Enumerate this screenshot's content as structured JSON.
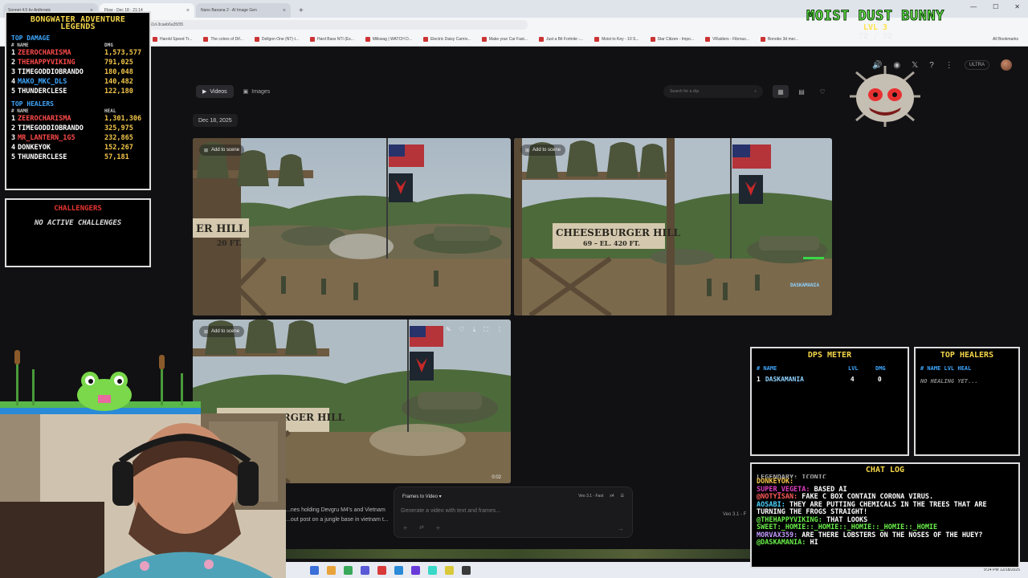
{
  "browser": {
    "tabs": [
      {
        "label": "Sonnet 4.5 by Anthropic"
      },
      {
        "label": "Flow - Dec 18 - 21:14"
      },
      {
        "label": "Nano Banana 2 - AI Image Gen"
      }
    ],
    "new_tab": "+",
    "url": "labs.google/fx/tools/flow/project/38f06194-2a28-425a-a51d-3caeb6a35f35",
    "bookmarks": [
      "Harold Speed Tr...",
      "The colors of Dif...",
      "Dellgon One (NT) t...",
      "Hard Bass NTI (Ex...",
      "Milkwag | WATCH D...",
      "Electric Daisy Carniv...",
      "Make your Car Fast...",
      "Just a Bit Fortnite -...",
      "Moist to Key - 10 S...",
      "Star Citizen - Impo...",
      "VRaiders - Fibrous...",
      "Bonobo 3d mer..."
    ],
    "all_bookmarks": "All Bookmarks"
  },
  "app": {
    "badge": "ULTRA",
    "tabs": {
      "videos": "Videos",
      "images": "Images"
    },
    "search_placeholder": "Search for a clip",
    "date": "Dec 18, 2025",
    "add_to_scene": "Add to scene",
    "sign_line1": "CHEESEBURGER HILL",
    "sign_line2": "69 – EL. 420 FT.",
    "sign_partial": "ER HILL",
    "sign_partial2": "20 FT.",
    "clip3_duration": "0:02",
    "prompt": {
      "mode": "Frames to Video",
      "model": "Veo 3.1 - Fast",
      "count": "x4",
      "placeholder": "Generate a video with text and frames..."
    },
    "bg_caption": "...nes holding Devgru M4's and Vietnam ...out post on a jungle base in vietnam t...",
    "veo_tag": "Veo 3.1 - F"
  },
  "overlay": {
    "legends": {
      "title": "BONGWATER ADVENTURE LEGENDS",
      "damage_title": "TOP DAMAGE",
      "damage_cols": {
        "name": "# NAME",
        "val": "DMG"
      },
      "damage_rows": [
        {
          "rank": "1",
          "name": "ZEEROCHARISMA",
          "value": "1,573,577",
          "color": "#ff4a4a"
        },
        {
          "rank": "2",
          "name": "THEHAPPYVIKING",
          "value": "791,025",
          "color": "#ff4a4a"
        },
        {
          "rank": "3",
          "name": "TIMEGODDIOBRANDO",
          "value": "180,048",
          "color": "#ffffff"
        },
        {
          "rank": "4",
          "name": "MAKO_MKC_DLS",
          "value": "140,482",
          "color": "#3ea7ff"
        },
        {
          "rank": "5",
          "name": "THUNDERCLESE",
          "value": "122,180",
          "color": "#ffffff"
        }
      ],
      "heal_title": "TOP HEALERS",
      "heal_cols": {
        "name": "# NAME",
        "val": "HEAL"
      },
      "heal_rows": [
        {
          "rank": "1",
          "name": "ZEEROCHARISMA",
          "value": "1,301,306",
          "color": "#ff4a4a"
        },
        {
          "rank": "2",
          "name": "TIMEGODDIOBRANDO",
          "value": "325,975",
          "color": "#ffffff"
        },
        {
          "rank": "3",
          "name": "MR_LANTERN_1G5",
          "value": "232,865",
          "color": "#ff4a4a"
        },
        {
          "rank": "4",
          "name": "DONKEYOK",
          "value": "152,267",
          "color": "#ffffff"
        },
        {
          "rank": "5",
          "name": "THUNDERCLESE",
          "value": "57,181",
          "color": "#ffffff"
        }
      ]
    },
    "challengers": {
      "title": "CHALLENGERS",
      "empty": "NO ACTIVE CHALLENGES"
    },
    "boss": {
      "name": "MOIST DUST BUNNY",
      "level": "LVL 3",
      "hp": "72 / 72"
    },
    "dps": {
      "title": "DPS METER",
      "cols": {
        "name": "# NAME",
        "lvl": "LVL",
        "dmg": "DMG"
      },
      "rows": [
        {
          "rank": "1",
          "name": "DASKAMANIA",
          "lvl": "4",
          "dmg": "0"
        }
      ]
    },
    "heal": {
      "title": "TOP HEALERS",
      "cols": "# NAME  LVL  HEAL",
      "empty": "NO HEALING YET..."
    },
    "player_tag": "DASKAMANIA",
    "chat": {
      "title": "CHAT LOG",
      "lines": [
        {
          "user": "DONKEYOK:",
          "text": "",
          "cls": "u1"
        },
        {
          "user": "SUPER_VEGETA:",
          "text": " BASED AI",
          "cls": "u2"
        },
        {
          "user": "@NOTYISAN:",
          "text": " FAKE C BOX CONTAIN CORONA VIRUS.",
          "cls": "u3"
        },
        {
          "user": "AOSABI:",
          "text": " THEY ARE PUTTING CHEMICALS IN THE TREES THAT ARE TURNING THE FROGS STRAIGHT!",
          "cls": "u4"
        },
        {
          "user": "@THEHAPPYVIKING:",
          "text": " THAT LOOKS",
          "cls": "u5"
        },
        {
          "user": "SWEET:_HOMIE::_HOMIE::_HOMIE::_HOMIE::_HOMIE",
          "text": "",
          "cls": "u5"
        },
        {
          "user": "MORVAX359:",
          "text": " ARE THERE LOBSTERS ON THE NOSES OF THE HUEY?",
          "cls": "u6"
        },
        {
          "user": "@DASKAMANIA:",
          "text": " HI",
          "cls": "u5"
        }
      ]
    }
  },
  "taskbar": {
    "clock": "9:14 PM 12/18/2025"
  }
}
